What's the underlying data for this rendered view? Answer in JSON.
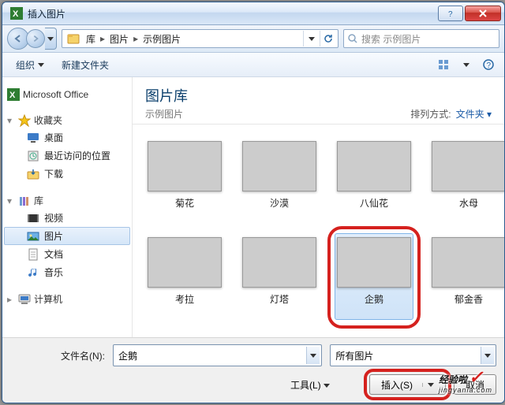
{
  "window": {
    "title": "插入图片"
  },
  "address": {
    "root": "库",
    "mid": "图片",
    "leaf": "示例图片"
  },
  "search": {
    "placeholder": "搜索 示例图片"
  },
  "toolbar": {
    "organize": "组织",
    "newfolder": "新建文件夹"
  },
  "sidebar": {
    "office": "Microsoft Office",
    "fav": "收藏夹",
    "fav_items": [
      "桌面",
      "最近访问的位置",
      "下载"
    ],
    "lib": "库",
    "lib_items": [
      "视频",
      "图片",
      "文档",
      "音乐"
    ],
    "computer": "计算机"
  },
  "library": {
    "title": "图片库",
    "subtitle": "示例图片",
    "arrange_label": "排列方式:",
    "arrange_value": "文件夹"
  },
  "thumbs": [
    {
      "name": "菊花"
    },
    {
      "name": "沙漠"
    },
    {
      "name": "八仙花"
    },
    {
      "name": "水母"
    },
    {
      "name": "考拉"
    },
    {
      "name": "灯塔"
    },
    {
      "name": "企鹅"
    },
    {
      "name": "郁金香"
    }
  ],
  "footer": {
    "filename_label": "文件名(N):",
    "filename_value": "企鹅",
    "filter_value": "所有图片",
    "tools_label": "工具(L)",
    "insert_label": "插入(S)",
    "cancel_label": "取消"
  },
  "watermark": {
    "main": "经验啦",
    "sub": "jingyanla.com"
  }
}
